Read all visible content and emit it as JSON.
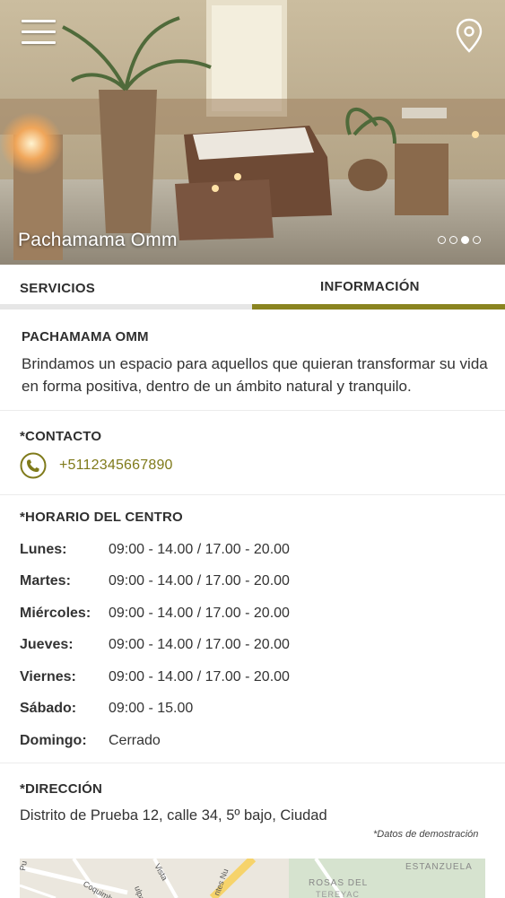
{
  "hero": {
    "title": "Pachamama Omm",
    "menu_icon": "hamburger-icon",
    "location_icon": "map-pin-icon",
    "slides": [
      false,
      false,
      true,
      false
    ]
  },
  "tabs": [
    {
      "label": "SERVICIOS",
      "active": false
    },
    {
      "label": "INFORMACIÓN",
      "active": true
    }
  ],
  "colors": {
    "accent": "#8a8420",
    "link": "#7f7a1a",
    "inactive_tab": "#e6e6e6"
  },
  "about": {
    "title": "PACHAMAMA OMM",
    "text": "Brindamos un espacio para aquellos que quieran transformar su vida en forma positiva, dentro de un ámbito natural y tranquilo."
  },
  "contact": {
    "title": "*CONTACTO",
    "icon": "phone-icon",
    "phone": "+5112345667890"
  },
  "hours": {
    "title": "*HORARIO DEL CENTRO",
    "rows": [
      {
        "day": "Lunes:",
        "time": "09:00 - 14.00  /  17.00 - 20.00"
      },
      {
        "day": "Martes:",
        "time": "09:00 - 14.00  /  17.00 - 20.00"
      },
      {
        "day": "Miércoles:",
        "time": "09:00 - 14.00  /  17.00 - 20.00"
      },
      {
        "day": "Jueves:",
        "time": "09:00 - 14.00  /  17.00 - 20.00"
      },
      {
        "day": "Viernes:",
        "time": "09:00 - 14.00  /  17.00 - 20.00"
      },
      {
        "day": "Sábado:",
        "time": "09:00 - 15.00"
      },
      {
        "day": "Domingo:",
        "time": "Cerrado"
      }
    ]
  },
  "address": {
    "title": "*DIRECCIÓN",
    "text": "Distrito de Prueba 12, calle 34, 5º bajo, Ciudad",
    "note": "*Datos de demostración",
    "map_labels": [
      "ESTANZUELA",
      "ROSAS DEL",
      "TEREYAC",
      "Coquimbo",
      "Vista",
      "ntes Nu",
      "Pu",
      "ulpa"
    ]
  }
}
